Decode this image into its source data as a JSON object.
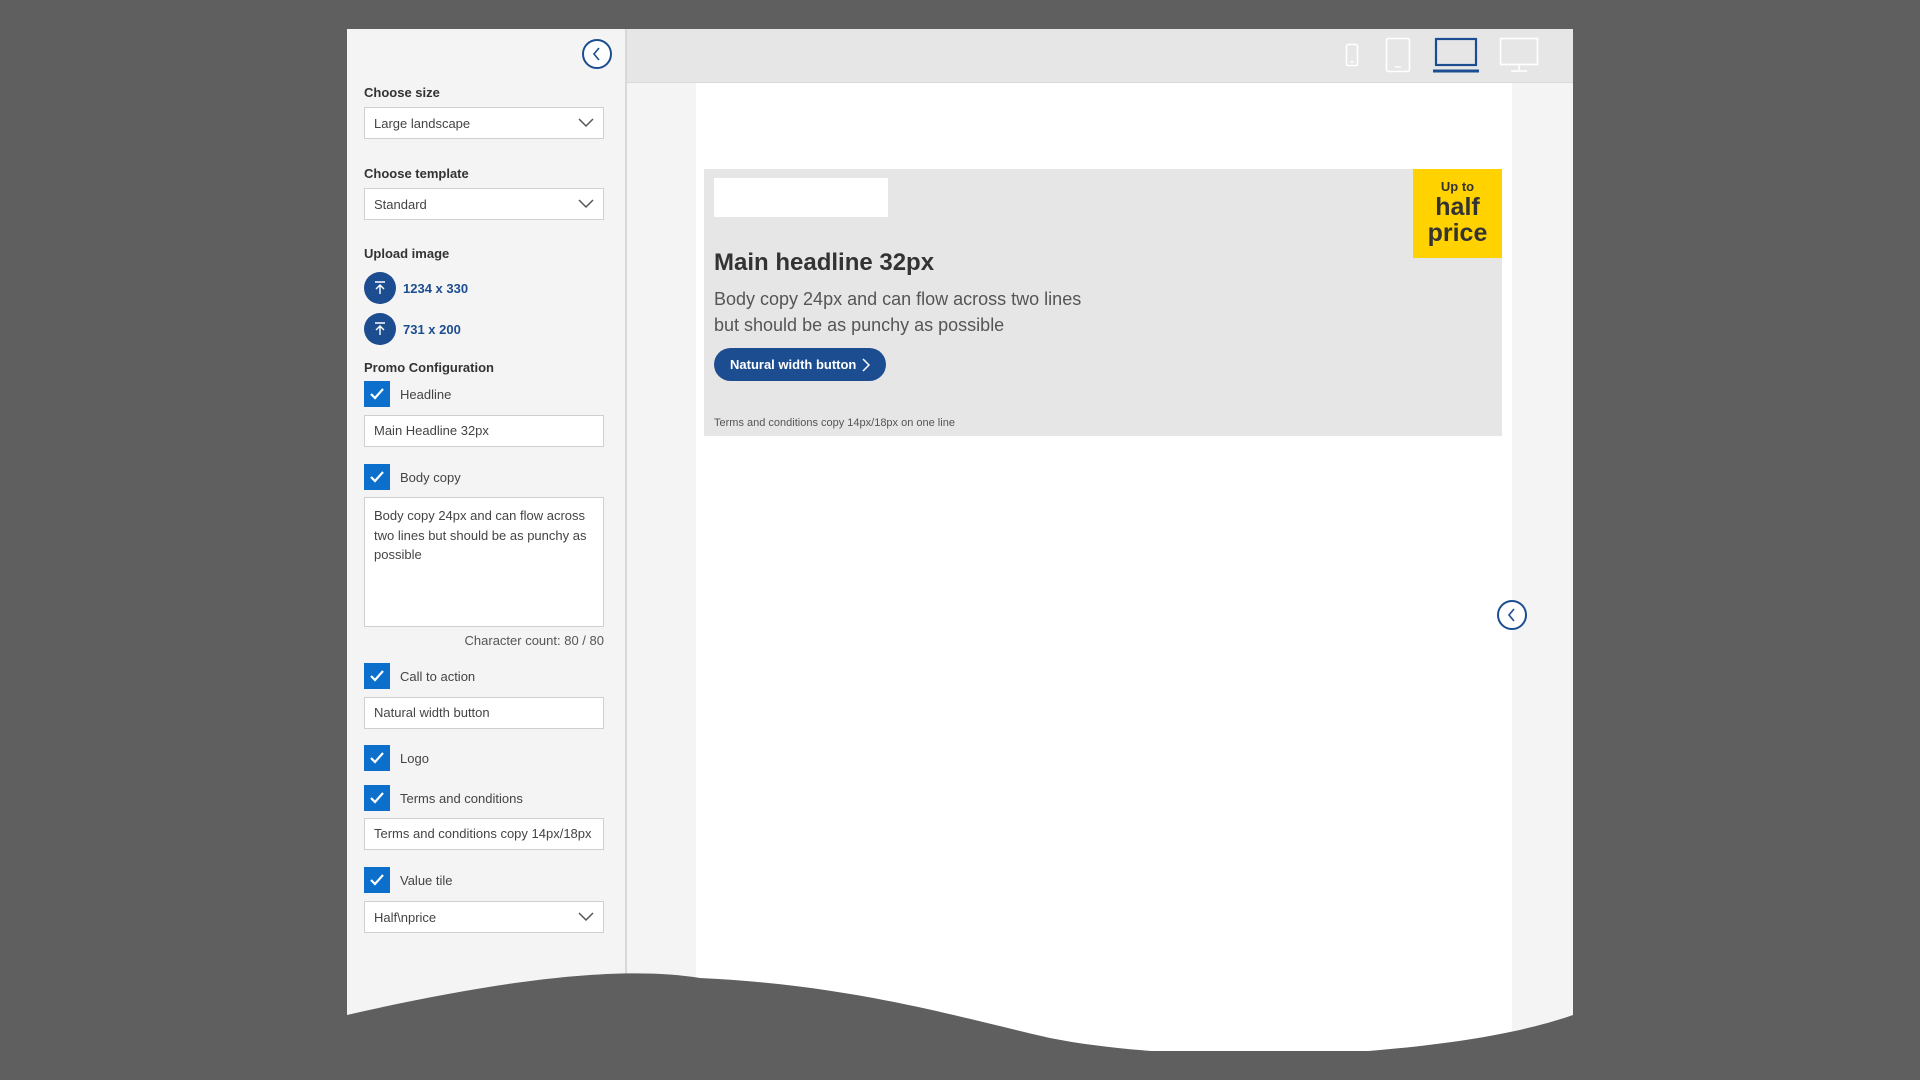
{
  "sidebar": {
    "size": {
      "label": "Choose size",
      "value": "Large landscape"
    },
    "template": {
      "label": "Choose template",
      "value": "Standard"
    },
    "upload": {
      "label": "Upload image",
      "items": [
        "1234 x 330",
        "731 x 200"
      ]
    },
    "promo": {
      "label": "Promo Configuration",
      "headline": {
        "label": "Headline",
        "value": "Main Headline 32px"
      },
      "body": {
        "label": "Body copy",
        "value": "Body copy 24px and can flow across two lines but should be as punchy as possible",
        "char_count": "Character count: 80 / 80"
      },
      "cta": {
        "label": "Call to action",
        "value": "Natural width button"
      },
      "logo": {
        "label": "Logo"
      },
      "terms": {
        "label": "Terms and conditions",
        "value": "Terms and conditions copy 14px/18px"
      },
      "value_tile": {
        "label": "Value tile",
        "value": "Half\\nprice"
      }
    }
  },
  "toolbar": {
    "devices": [
      "mobile-icon",
      "tablet-icon",
      "laptop-icon",
      "desktop-icon"
    ],
    "selected": "laptop-icon"
  },
  "banner": {
    "headline": "Main headline 32px",
    "body": "Body copy 24px and can flow across two lines but should be as punchy as possible",
    "cta": "Natural width button",
    "terms": "Terms and conditions copy 14px/18px on one line",
    "value_tile": {
      "small": "Up to",
      "line1": "half",
      "line2": "price"
    }
  },
  "colors": {
    "brand_blue": "#1d4d91",
    "checkbox_blue": "#0d6fcc",
    "value_tile": "#ffd200",
    "banner_bg": "#e6e6e6"
  }
}
